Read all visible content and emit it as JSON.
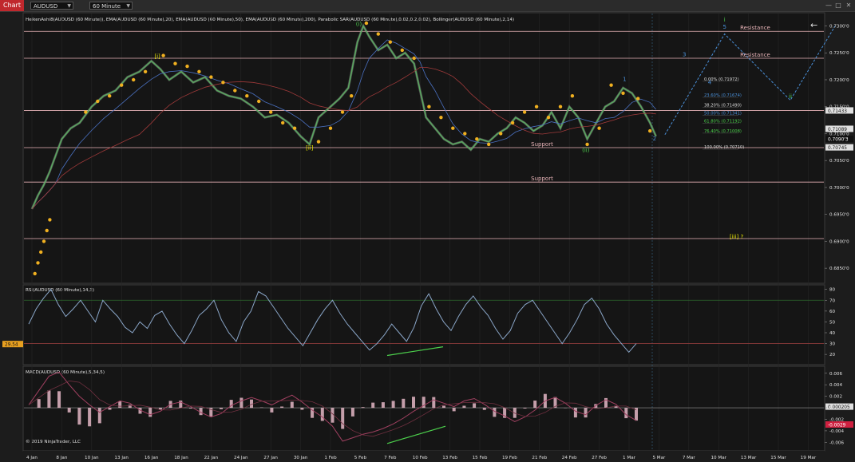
{
  "toolbar": {
    "chart_label": "Chart",
    "instrument": "AUDUSD",
    "interval": "60 Minute"
  },
  "indicators_label": "HeikenAshi8(AUDUSD (60 Minute)), EMA(AUDUSD (60 Minute),20), EMA(AUDUSD (60 Minute),50), EMA(AUDUSD (60 Minute),200), Parabolic SAR(AUDUSD (60 Minute),0.02,0.2,0.02), Bollinger(AUDUSD (60 Minute),2,14)",
  "rsi_label": "RSI(AUDUSD (60 Minute),14,3)",
  "macd_label": "MACD(AUDUSD (60 Minute),5,34,5)",
  "copyright": "© 2019 NinjaTrader, LLC",
  "colors": {
    "background": "#1c1c1c",
    "resistance_line": "#e8b4b8",
    "support_line": "#e8b4b8",
    "wave_label_yellow": "#e6e600",
    "wave_label_green": "#4cd04c",
    "projection_blue": "#4a90d9",
    "psar_dots": "#f0b020",
    "rsi_line": "#8aa6c8",
    "macd_line": "#a04060"
  },
  "chart_data": {
    "type": "line",
    "main_panel": {
      "ylim": [
        0.6825,
        0.732
      ],
      "y_ticks": [
        "0.7300'0",
        "0.7250'0",
        "0.7200'0",
        "0.7150'0",
        "0.7100'0",
        "0.7050'0",
        "0.7000'0",
        "0.6950'0",
        "0.6900'0",
        "0.6850'0"
      ],
      "y_tick_values": [
        0.73,
        0.725,
        0.72,
        0.715,
        0.71,
        0.705,
        0.7,
        0.695,
        0.69,
        0.685
      ],
      "x_ticks": [
        "4 Jan",
        "8 Jan",
        "10 Jan",
        "13 Jan",
        "16 Jan",
        "18 Jan",
        "22 Jan",
        "24 Jan",
        "27 Jan",
        "30 Jan",
        "1 Feb",
        "5 Feb",
        "7 Feb",
        "10 Feb",
        "13 Feb",
        "15 Feb",
        "19 Feb",
        "21 Feb",
        "24 Feb",
        "27 Feb",
        "1 Mar",
        "5 Mar",
        "7 Mar",
        "10 Mar",
        "13 Mar",
        "15 Mar",
        "19 Mar"
      ],
      "horizontal_levels": [
        {
          "value": 0.729,
          "label": "Resistance"
        },
        {
          "value": 0.724,
          "label": "Resistance"
        },
        {
          "value": 0.7143,
          "label": ""
        },
        {
          "value": 0.7074,
          "label": "Support"
        },
        {
          "value": 0.701,
          "label": "Support"
        },
        {
          "value": 0.6905,
          "label": ""
        }
      ],
      "price_badges": [
        {
          "value": 0.7143,
          "text": "0.71433"
        },
        {
          "value": 0.71089,
          "text": "0.71089"
        },
        {
          "value": 0.70903,
          "text": "0.7090'3"
        },
        {
          "value": 0.70745,
          "text": "0.70745"
        }
      ],
      "fib_levels": [
        {
          "text": "0.00% (0.71972)",
          "value": 0.71972,
          "color": "#dddddd"
        },
        {
          "text": "23.60% (0.71674)",
          "value": 0.71674,
          "color": "#4a90d9"
        },
        {
          "text": "38.20% (0.71490)",
          "value": 0.7149,
          "color": "#dddddd"
        },
        {
          "text": "50.00% (0.71341)",
          "value": 0.71341,
          "color": "#4a90d9"
        },
        {
          "text": "61.80% (0.71192)",
          "value": 0.71192,
          "color": "#4cd04c"
        },
        {
          "text": "76.40% (0.71008)",
          "value": 0.71008,
          "color": "#4cd04c"
        },
        {
          "text": "100.00% (0.70710)",
          "value": 0.7071,
          "color": "#dddddd"
        }
      ],
      "wave_labels": [
        {
          "text": "[i]",
          "x_index": 4.2,
          "value": 0.724,
          "color": "#e6e600"
        },
        {
          "text": "[ii]",
          "x_index": 9.3,
          "value": 0.707,
          "color": "#e6e600"
        },
        {
          "text": "(i)",
          "x_index": 10.95,
          "value": 0.73,
          "color": "#4cd04c"
        },
        {
          "text": "(ii)",
          "x_index": 18.55,
          "value": 0.7066,
          "color": "#4cd04c"
        },
        {
          "text": "1",
          "x_index": 19.85,
          "value": 0.7198,
          "color": "#4a90d9"
        },
        {
          "text": "2",
          "x_index": 20.85,
          "value": 0.7087,
          "color": "#4a90d9"
        },
        {
          "text": "3",
          "x_index": 21.85,
          "value": 0.7244,
          "color": "#4a90d9"
        },
        {
          "text": "4",
          "x_index": 22.7,
          "value": 0.7192,
          "color": "#4a90d9"
        },
        {
          "text": "i",
          "x_index": 23.2,
          "value": 0.7308,
          "color": "#4cd04c"
        },
        {
          "text": "5",
          "x_index": 23.2,
          "value": 0.7295,
          "color": "#4a90d9"
        },
        {
          "text": "ii",
          "x_index": 25.4,
          "value": 0.7166,
          "color": "#4cd04c"
        },
        {
          "text": "[iii] ?",
          "x_index": 23.6,
          "value": 0.6905,
          "color": "#e6e600"
        }
      ],
      "projection": {
        "x_index": [
          21.2,
          23.2,
          25.4,
          26.9
        ],
        "values": [
          0.7098,
          0.7285,
          0.7162,
          0.73
        ]
      },
      "price_series": {
        "x_index": [
          0,
          0.2,
          0.4,
          0.6,
          0.8,
          1,
          1.3,
          1.6,
          2,
          2.4,
          2.8,
          3.2,
          3.6,
          4,
          4.3,
          4.6,
          5,
          5.4,
          5.8,
          6.2,
          6.6,
          7,
          7.4,
          7.8,
          8.2,
          8.6,
          9,
          9.3,
          9.6,
          10,
          10.3,
          10.6,
          10.9,
          11.1,
          11.3,
          11.6,
          11.9,
          12.2,
          12.5,
          12.8,
          13,
          13.2,
          13.5,
          13.8,
          14.1,
          14.4,
          14.7,
          15,
          15.3,
          15.6,
          15.9,
          16.2,
          16.5,
          16.8,
          17.1,
          17.4,
          17.7,
          18,
          18.3,
          18.6,
          18.9,
          19.2,
          19.5,
          19.8,
          20.1,
          20.4,
          20.7,
          20.9
        ],
        "values": [
          0.696,
          0.6985,
          0.7005,
          0.703,
          0.706,
          0.709,
          0.711,
          0.712,
          0.715,
          0.717,
          0.718,
          0.7205,
          0.7215,
          0.7235,
          0.722,
          0.72,
          0.7215,
          0.7195,
          0.7205,
          0.718,
          0.717,
          0.7165,
          0.715,
          0.713,
          0.7135,
          0.712,
          0.7095,
          0.708,
          0.713,
          0.715,
          0.7165,
          0.7185,
          0.727,
          0.73,
          0.728,
          0.7255,
          0.7265,
          0.724,
          0.725,
          0.723,
          0.718,
          0.713,
          0.711,
          0.709,
          0.708,
          0.7085,
          0.707,
          0.709,
          0.7085,
          0.71,
          0.711,
          0.713,
          0.712,
          0.7105,
          0.7115,
          0.714,
          0.711,
          0.715,
          0.713,
          0.709,
          0.712,
          0.715,
          0.716,
          0.7185,
          0.7175,
          0.715,
          0.712,
          0.7095
        ]
      },
      "psar_dots": {
        "x_index": [
          0.1,
          0.2,
          0.3,
          0.4,
          0.5,
          0.6,
          1.8,
          2.2,
          2.6,
          3,
          3.4,
          3.8,
          4.4,
          4.8,
          5.2,
          5.6,
          6,
          6.4,
          6.8,
          7.2,
          7.6,
          8,
          8.4,
          8.8,
          9.6,
          10.0,
          10.4,
          10.7,
          11.2,
          11.6,
          12,
          12.4,
          12.8,
          13.3,
          13.7,
          14.1,
          14.5,
          14.9,
          15.3,
          15.7,
          16.1,
          16.5,
          16.9,
          17.3,
          17.7,
          18.1,
          18.6,
          19,
          19.4,
          19.8,
          20.3,
          20.7
        ],
        "values": [
          0.684,
          0.686,
          0.688,
          0.69,
          0.692,
          0.694,
          0.714,
          0.716,
          0.717,
          0.719,
          0.72,
          0.7215,
          0.7245,
          0.723,
          0.7225,
          0.7215,
          0.7205,
          0.7195,
          0.718,
          0.717,
          0.716,
          0.714,
          0.712,
          0.711,
          0.7085,
          0.711,
          0.714,
          0.717,
          0.7305,
          0.7285,
          0.727,
          0.7255,
          0.724,
          0.715,
          0.713,
          0.711,
          0.71,
          0.709,
          0.708,
          0.71,
          0.712,
          0.714,
          0.715,
          0.713,
          0.715,
          0.717,
          0.708,
          0.711,
          0.719,
          0.7175,
          0.7165,
          0.7105
        ]
      }
    },
    "rsi_panel": {
      "ylim": [
        12,
        82
      ],
      "y_ticks": [
        "80",
        "70",
        "60",
        "50",
        "40",
        "30",
        "20"
      ],
      "y_tick_values": [
        80,
        70,
        60,
        50,
        40,
        30,
        20
      ],
      "levels": [
        70,
        30
      ],
      "badges": [
        {
          "value": 29.54,
          "text": "29.54"
        }
      ],
      "series": [
        48,
        62,
        72,
        80,
        66,
        55,
        62,
        70,
        60,
        50,
        70,
        62,
        55,
        45,
        40,
        50,
        44,
        56,
        60,
        48,
        38,
        30,
        42,
        56,
        62,
        70,
        52,
        40,
        32,
        50,
        60,
        78,
        74,
        64,
        54,
        44,
        36,
        28,
        40,
        52,
        62,
        70,
        58,
        48,
        40,
        32,
        24,
        30,
        38,
        48,
        40,
        32,
        45,
        65,
        76,
        62,
        50,
        42,
        55,
        66,
        74,
        64,
        56,
        44,
        34,
        42,
        58,
        66,
        70,
        60,
        50,
        40,
        30,
        40,
        52,
        66,
        72,
        62,
        48,
        38,
        30,
        22,
        30
      ]
    },
    "macd_panel": {
      "ylim": [
        -0.0072,
        0.0068
      ],
      "y_ticks": [
        "0.006",
        "0.004",
        "0.002",
        "0",
        "-0.002",
        "-0.004",
        "-0.006"
      ],
      "y_tick_values": [
        0.006,
        0.004,
        0.002,
        0,
        -0.002,
        -0.004,
        -0.006
      ],
      "badges": [
        {
          "value": 0.000205,
          "text": "0.000205"
        },
        {
          "value": -0.0029,
          "text": "-0.0029"
        }
      ],
      "series": [
        0.0005,
        0.003,
        0.0055,
        0.0062,
        0.004,
        0.002,
        0.0005,
        -0.0008,
        0.0002,
        0.0012,
        0.0008,
        -0.0004,
        -0.0012,
        -0.0006,
        0.0006,
        0.001,
        0.0002,
        -0.0008,
        -0.0016,
        -0.001,
        0.0004,
        0.0012,
        0.0018,
        0.0012,
        0.0005,
        0.0014,
        0.0022,
        0.001,
        -0.0004,
        -0.0016,
        -0.0032,
        -0.0058,
        -0.0052,
        -0.0046,
        -0.0042,
        -0.0036,
        -0.0028,
        -0.0018,
        -0.0006,
        0.0004,
        0.0014,
        0.0008,
        0.0002,
        0.0012,
        0.0016,
        0.0006,
        -0.0006,
        -0.0014,
        -0.0024,
        -0.0016,
        -0.0004,
        0.0012,
        0.0018,
        0.0008,
        -0.0006,
        -0.0012,
        0.0004,
        0.0014,
        0.0006,
        -0.0012,
        -0.0022
      ]
    }
  }
}
